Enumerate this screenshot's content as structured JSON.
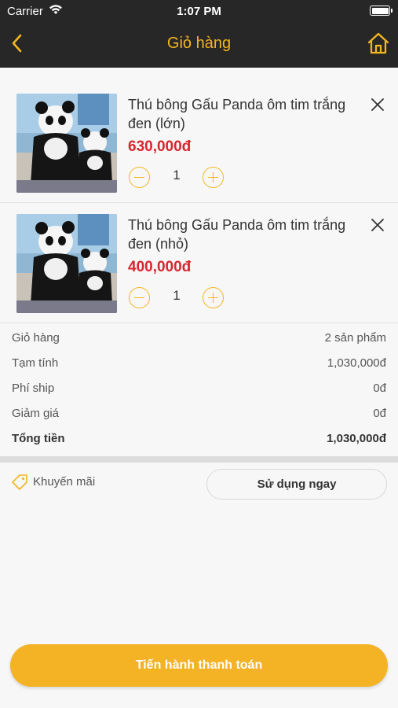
{
  "status_bar": {
    "carrier": "Carrier",
    "time": "1:07 PM"
  },
  "nav": {
    "title": "Giỏ hàng"
  },
  "cart_items": [
    {
      "name": "Thú bông Gấu Panda ôm tim trắng đen (lớn)",
      "price": "630,000đ",
      "quantity": "1"
    },
    {
      "name": "Thú bông Gấu Panda ôm tim trắng đen (nhỏ)",
      "price": "400,000đ",
      "quantity": "1"
    }
  ],
  "summary": {
    "cart_label": "Giỏ hàng",
    "cart_value": "2 sản phẩm",
    "subtotal_label": "Tạm tính",
    "subtotal_value": "1,030,000đ",
    "shipping_label": "Phí ship",
    "shipping_value": "0đ",
    "discount_label": "Giảm giá",
    "discount_value": "0đ",
    "total_label": "Tổng tiền",
    "total_value": "1,030,000đ"
  },
  "promo": {
    "label": "Khuyến mãi",
    "button": "Sử dụng ngay"
  },
  "checkout": {
    "label": "Tiến hành thanh toán"
  },
  "colors": {
    "accent": "#f4b620",
    "price": "#d8262e",
    "header_bg": "#272727"
  },
  "icons": [
    "back-arrow-icon",
    "home-icon",
    "close-icon",
    "minus-icon",
    "plus-icon",
    "tag-icon",
    "wifi-icon",
    "battery-icon"
  ]
}
